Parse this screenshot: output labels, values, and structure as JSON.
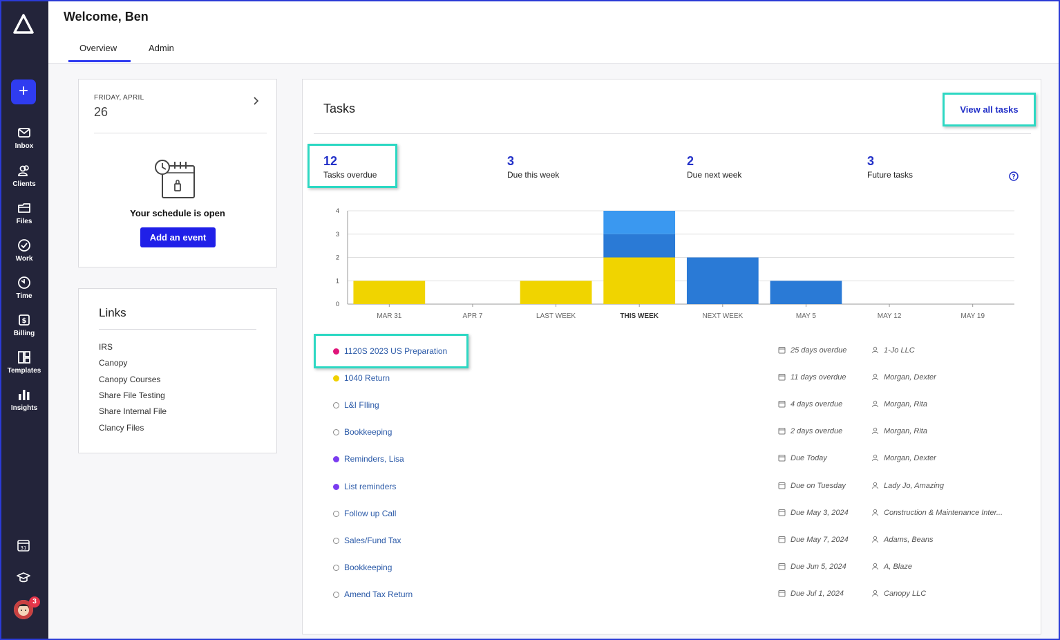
{
  "header": {
    "welcome": "Welcome, Ben",
    "tabs": [
      {
        "label": "Overview",
        "active": true
      },
      {
        "label": "Admin",
        "active": false
      }
    ]
  },
  "sidebar": {
    "items": [
      {
        "label": "Inbox",
        "icon": "mail-icon"
      },
      {
        "label": "Clients",
        "icon": "clients-icon"
      },
      {
        "label": "Files",
        "icon": "folder-icon"
      },
      {
        "label": "Work",
        "icon": "check-circle-icon"
      },
      {
        "label": "Time",
        "icon": "timer-icon"
      },
      {
        "label": "Billing",
        "icon": "dollar-icon"
      },
      {
        "label": "Templates",
        "icon": "templates-icon"
      },
      {
        "label": "Insights",
        "icon": "bar-chart-icon"
      }
    ],
    "calendar_icon_text": "31",
    "notification_count": "3",
    "accent": "#2f3cf0"
  },
  "schedule": {
    "day_label": "FRIDAY, APRIL",
    "date": "26",
    "message": "Your schedule is open",
    "button": "Add an event"
  },
  "links": {
    "title": "Links",
    "items": [
      "IRS",
      "Canopy",
      "Canopy Courses",
      "Share File Testing",
      "Share Internal File",
      "Clancy Files"
    ]
  },
  "tasks": {
    "title": "Tasks",
    "view_all": "View all tasks",
    "stats": [
      {
        "value": "12",
        "label": "Tasks overdue"
      },
      {
        "value": "3",
        "label": "Due this week"
      },
      {
        "value": "2",
        "label": "Due next week"
      },
      {
        "value": "3",
        "label": "Future tasks"
      }
    ],
    "list": [
      {
        "name": "1120S 2023 US Preparation",
        "due": "25 days overdue",
        "client": "1-Jo LLC",
        "dot": "#e0157a",
        "hollow": false
      },
      {
        "name": "1040 Return",
        "due": "11 days overdue",
        "client": "Morgan, Dexter",
        "dot": "#f0d000",
        "hollow": false
      },
      {
        "name": "L&I FIling",
        "due": "4 days overdue",
        "client": "Morgan, Rita",
        "dot": "",
        "hollow": true
      },
      {
        "name": "Bookkeeping",
        "due": "2 days overdue",
        "client": "Morgan, Rita",
        "dot": "",
        "hollow": true
      },
      {
        "name": "Reminders, Lisa",
        "due": "Due Today",
        "client": "Morgan, Dexter",
        "dot": "#7a3cf0",
        "hollow": false
      },
      {
        "name": "List reminders",
        "due": "Due on Tuesday",
        "client": "Lady Jo, Amazing",
        "dot": "#7a3cf0",
        "hollow": false
      },
      {
        "name": "Follow up Call",
        "due": "Due May 3, 2024",
        "client": "Construction & Maintenance Inter...",
        "dot": "",
        "hollow": true
      },
      {
        "name": "Sales/Fund Tax",
        "due": "Due May 7, 2024",
        "client": "Adams, Beans",
        "dot": "",
        "hollow": true
      },
      {
        "name": "Bookkeeping",
        "due": "Due Jun 5, 2024",
        "client": "A, Blaze",
        "dot": "",
        "hollow": true
      },
      {
        "name": "Amend Tax Return",
        "due": "Due Jul 1, 2024",
        "client": "Canopy LLC",
        "dot": "",
        "hollow": true
      }
    ]
  },
  "chart_data": {
    "type": "bar",
    "stacked": true,
    "categories": [
      "MAR 31",
      "APR 7",
      "LAST WEEK",
      "THIS WEEK",
      "NEXT WEEK",
      "MAY 5",
      "MAY 12",
      "MAY 19"
    ],
    "highlight_category": "THIS WEEK",
    "series": [
      {
        "color": "#f0d400",
        "values": [
          1,
          0,
          1,
          2,
          0,
          0,
          0,
          0
        ]
      },
      {
        "color": "#2a7ad6",
        "values": [
          0,
          0,
          0,
          1,
          2,
          1,
          0,
          0
        ]
      },
      {
        "color": "#3a98f0",
        "values": [
          0,
          0,
          0,
          1,
          0,
          0,
          0,
          0
        ]
      }
    ],
    "ylim": [
      0,
      4
    ],
    "yticks": [
      0,
      1,
      2,
      3,
      4
    ],
    "grid": true
  }
}
